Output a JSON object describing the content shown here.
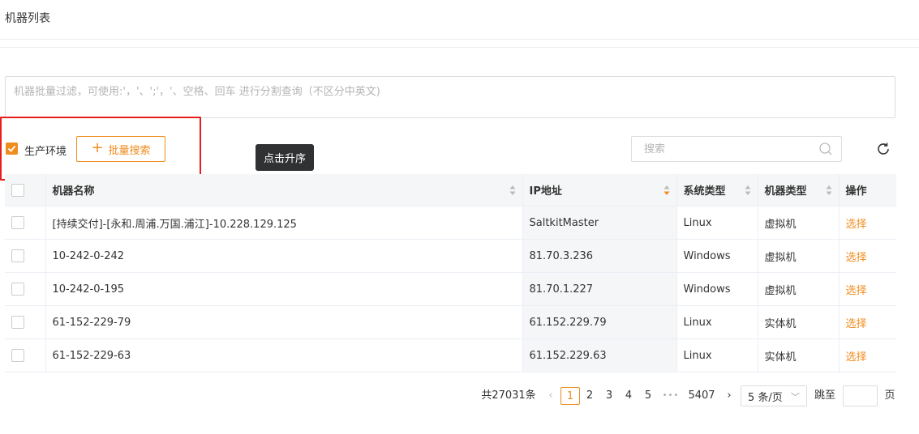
{
  "header": {
    "title": "机器列表"
  },
  "filter": {
    "placeholder": "机器批量过滤，可使用:'，'、';'，'、空格、回车 进行分割查询（不区分中英文)"
  },
  "toolbar": {
    "prod_env_label": "生产环境",
    "prod_env_checked": true,
    "batch_search_label": "批量搜索",
    "tooltip": "点击升序",
    "search_placeholder": "搜索"
  },
  "table": {
    "columns": [
      "机器名称",
      "IP地址",
      "系统类型",
      "机器类型",
      "操作"
    ],
    "rows": [
      {
        "name": "[持续交付]-[永和.周浦.万国.浦江]-10.228.129.125",
        "ip": "SaltkitMaster",
        "os": "Linux",
        "type": "虚拟机",
        "action": "选择"
      },
      {
        "name": "10-242-0-242",
        "ip": "81.70.3.236",
        "os": "Windows",
        "type": "虚拟机",
        "action": "选择"
      },
      {
        "name": "10-242-0-195",
        "ip": "81.70.1.227",
        "os": "Windows",
        "type": "虚拟机",
        "action": "选择"
      },
      {
        "name": "61-152-229-79",
        "ip": "61.152.229.79",
        "os": "Linux",
        "type": "实体机",
        "action": "选择"
      },
      {
        "name": "61-152-229-63",
        "ip": "61.152.229.63",
        "os": "Linux",
        "type": "实体机",
        "action": "选择"
      }
    ]
  },
  "pagination": {
    "total": "共27031条",
    "pages": [
      "1",
      "2",
      "3",
      "4",
      "5"
    ],
    "current": "1",
    "ellipsis": "•••",
    "last": "5407",
    "page_size": "5 条/页",
    "goto_label": "跳至",
    "page_suffix": "页"
  },
  "colors": {
    "accent": "#f08c1e",
    "danger": "#e61e1e",
    "highlight": "#e61e1e"
  }
}
